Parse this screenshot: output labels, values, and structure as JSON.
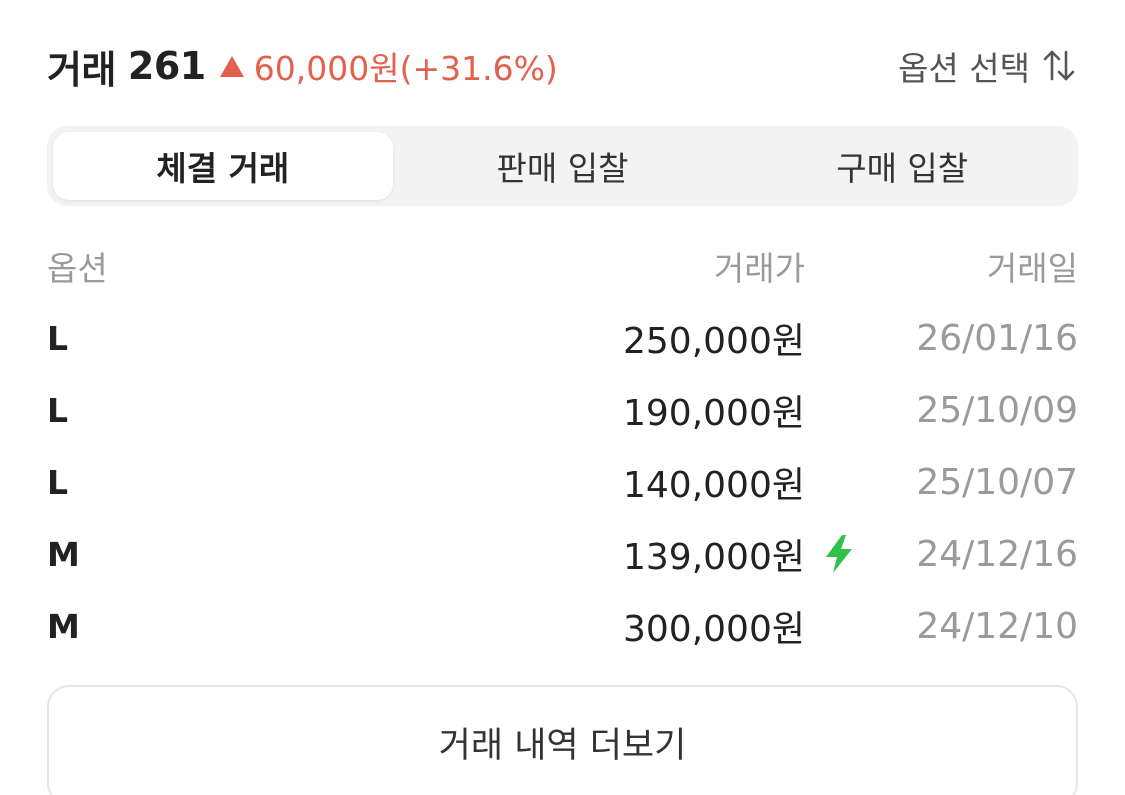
{
  "header": {
    "title": "거래",
    "count": "261",
    "change_text": "60,000원(+31.6%)",
    "option_select_label": "옵션 선택",
    "change_color": "#e3604c"
  },
  "tabs": [
    {
      "label": "체결 거래",
      "active": true
    },
    {
      "label": "판매 입찰",
      "active": false
    },
    {
      "label": "구매 입찰",
      "active": false
    }
  ],
  "table": {
    "columns": [
      "옵션",
      "거래가",
      "거래일"
    ],
    "rows": [
      {
        "option": "L",
        "price": "250,000원",
        "date": "26/01/16",
        "quick": false
      },
      {
        "option": "L",
        "price": "190,000원",
        "date": "25/10/09",
        "quick": false
      },
      {
        "option": "L",
        "price": "140,000원",
        "date": "25/10/07",
        "quick": false
      },
      {
        "option": "M",
        "price": "139,000원",
        "date": "24/12/16",
        "quick": true,
        "quick_icon": "lightning-bolt-icon"
      },
      {
        "option": "M",
        "price": "300,000원",
        "date": "24/12/10",
        "quick": false
      }
    ]
  },
  "more_button_label": "거래 내역 더보기"
}
